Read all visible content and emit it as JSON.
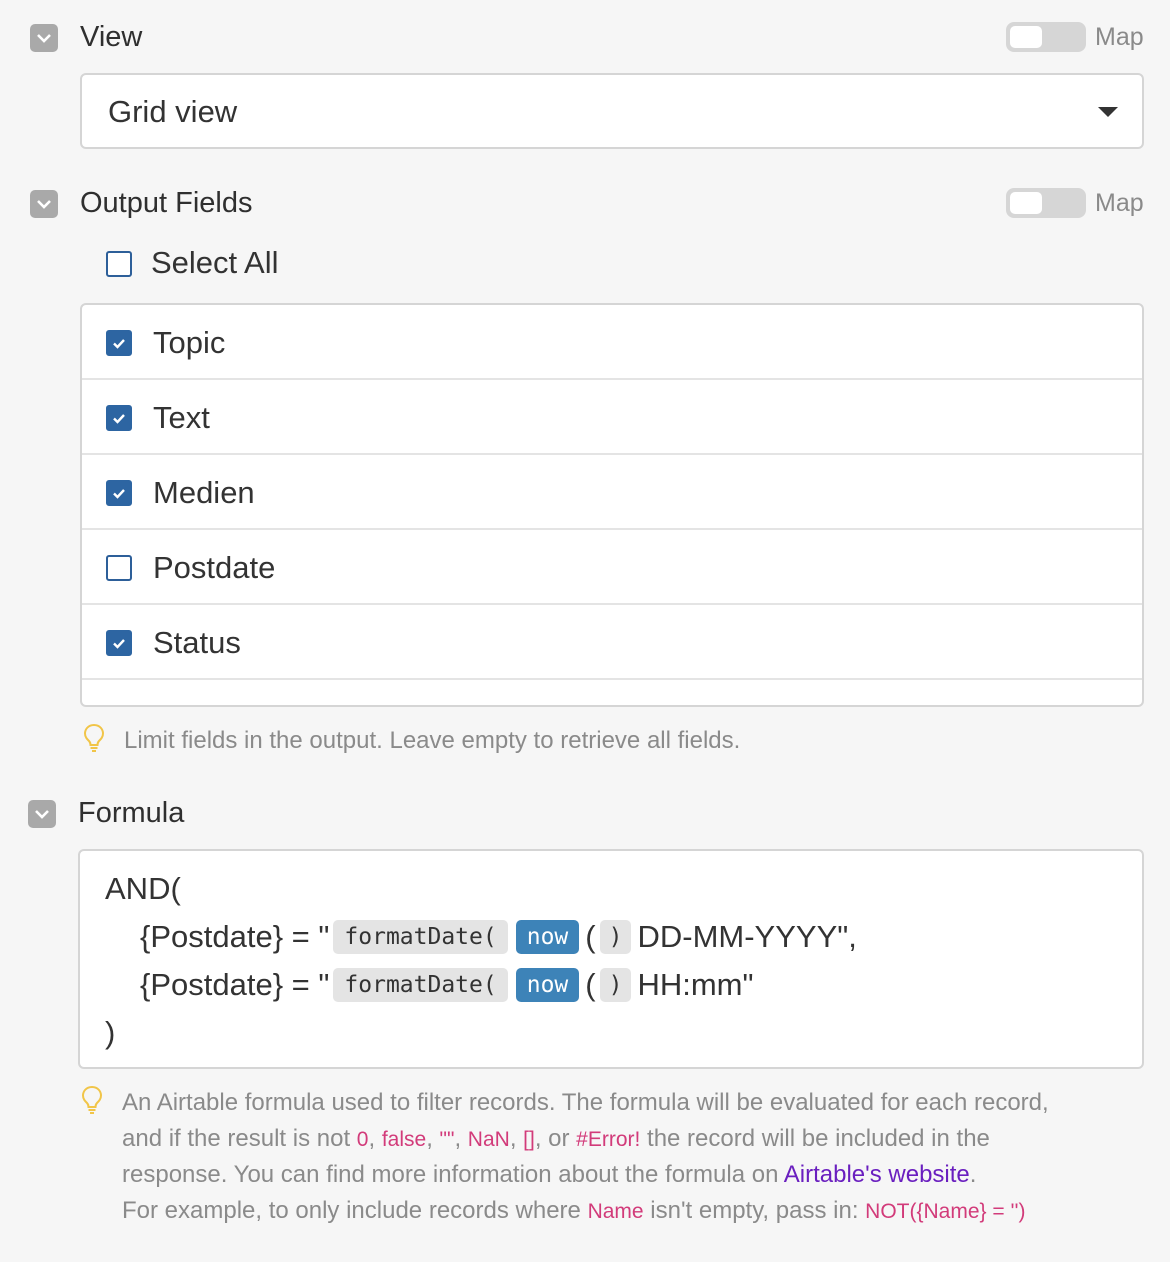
{
  "view_section": {
    "label": "View",
    "map_label": "Map",
    "selected_view": "Grid view"
  },
  "output_fields_section": {
    "label": "Output Fields",
    "map_label": "Map",
    "select_all_label": "Select All",
    "select_all_checked": false,
    "fields": [
      {
        "label": "Topic",
        "checked": true
      },
      {
        "label": "Text",
        "checked": true
      },
      {
        "label": "Medien",
        "checked": true
      },
      {
        "label": "Postdate",
        "checked": false
      },
      {
        "label": "Status",
        "checked": true
      }
    ],
    "hint": "Limit fields in the output. Leave empty to retrieve all fields."
  },
  "formula_section": {
    "label": "Formula",
    "code": {
      "line1": "AND(",
      "line2_prefix": "{Postdate} = \"",
      "line2_fn": "formatDate(",
      "line2_now": "now",
      "line2_paren": ")",
      "line2_suffix": "DD-MM-YYYY\",",
      "line3_prefix": "{Postdate} = \"",
      "line3_fn": "formatDate(",
      "line3_now": "now",
      "line3_paren": ")",
      "line3_suffix": "HH:mm\"",
      "line4": ")"
    },
    "help": {
      "p1": "An Airtable formula used to filter records. The formula will be evaluated for each record,",
      "p2_start": "and if the result is not ",
      "v0": "0",
      "comma1": ", ",
      "vfalse": "false",
      "comma2": ", ",
      "vempty": "\"\"",
      "comma3": ", ",
      "vnan": "NaN",
      "comma4": ", ",
      "varr": "[]",
      "or": ", or ",
      "verror": "#Error!",
      "p2_end": " the record will be included in the",
      "p3_start": "response. You can find more information about the formula on ",
      "link": "Airtable's website",
      "p3_end": ".",
      "p4_start": "For example, to only include records where ",
      "name_code": "Name",
      "p4_mid": " isn't empty, pass in: ",
      "example_code": "NOT({Name} = '')"
    }
  },
  "colors": {
    "checkbox": "#2d65a2",
    "now_pill": "#3d83b8",
    "code_text": "#d23b7a",
    "link": "#6a1fbf"
  }
}
